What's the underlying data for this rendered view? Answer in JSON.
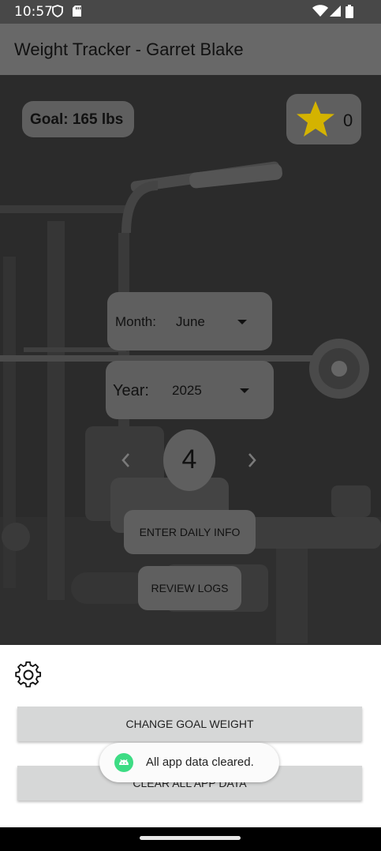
{
  "status_bar": {
    "time": "10:57",
    "icons": [
      "shield-icon",
      "sd-card-icon",
      "wifi-icon",
      "signal-icon",
      "battery-icon"
    ]
  },
  "app_bar": {
    "title": "Weight Tracker - Garret Blake"
  },
  "main": {
    "goal_label": "Goal: 165 lbs",
    "star_icon": "star-icon",
    "star_color": "#d4b300",
    "star_count": "0",
    "month": {
      "label": "Month:",
      "value": "June"
    },
    "year": {
      "label": "Year:",
      "value": "2025"
    },
    "day": {
      "value": "4",
      "prev_icon": "chevron-left-icon",
      "next_icon": "chevron-right-icon"
    },
    "enter_button": "ENTER DAILY INFO",
    "review_button": "REVIEW LOGS"
  },
  "bottom_sheet": {
    "settings_icon": "gear-icon",
    "change_goal_button": "CHANGE GOAL WEIGHT",
    "clear_data_button": "CLEAR ALL APP DATA"
  },
  "toast": {
    "icon": "android-icon",
    "message": "All app data cleared."
  }
}
